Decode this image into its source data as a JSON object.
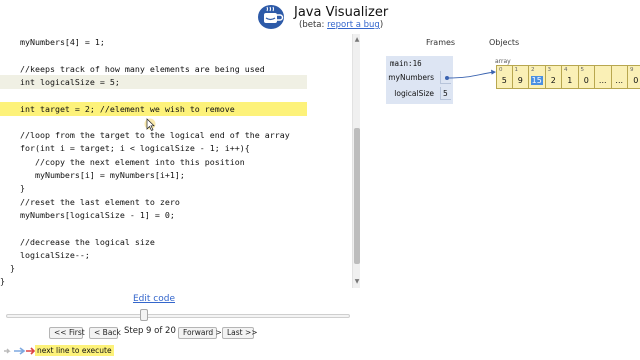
{
  "header": {
    "title": "Java Visualizer",
    "subtitle_prefix": "(beta: ",
    "report_link": "report a bug",
    "subtitle_suffix": ")",
    "logo_icon": "coffee-cup-logo"
  },
  "code": {
    "lines": [
      {
        "text": "    myNumbers[4] = 1;",
        "state": "normal"
      },
      {
        "text": "",
        "state": "normal"
      },
      {
        "text": "    //keeps track of how many elements are being used",
        "state": "normal"
      },
      {
        "text": "    int logicalSize = 5;",
        "state": "prev"
      },
      {
        "text": "",
        "state": "normal"
      },
      {
        "text": "    int target = 2; //element we wish to remove",
        "state": "cur"
      },
      {
        "text": "",
        "state": "normal"
      },
      {
        "text": "    //loop from the target to the logical end of the array",
        "state": "normal"
      },
      {
        "text": "    for(int i = target; i < logicalSize - 1; i++){",
        "state": "normal"
      },
      {
        "text": "       //copy the next element into this position",
        "state": "normal"
      },
      {
        "text": "       myNumbers[i] = myNumbers[i+1];",
        "state": "normal"
      },
      {
        "text": "    }",
        "state": "normal"
      },
      {
        "text": "    //reset the last element to zero",
        "state": "normal"
      },
      {
        "text": "    myNumbers[logicalSize - 1] = 0;",
        "state": "normal"
      },
      {
        "text": "",
        "state": "normal"
      },
      {
        "text": "    //decrease the logical size",
        "state": "normal"
      },
      {
        "text": "    logicalSize--;",
        "state": "normal"
      },
      {
        "text": "  }",
        "state": "normal"
      },
      {
        "text": "}",
        "state": "normal"
      }
    ],
    "highlight_colors": {
      "current": "#fdf27a",
      "previous": "#f0f0e4"
    }
  },
  "controls": {
    "edit_code": "Edit code",
    "first": "<< First",
    "back": "< Back",
    "step_text": "Step 9 of 20",
    "forward": "Forward >",
    "last": "Last >>",
    "slider_progress": 0.4
  },
  "legend": {
    "label": "next line to execute",
    "icon": "arrow-legend-icon"
  },
  "viz": {
    "frames_header": "Frames",
    "objects_header": "Objects",
    "frame": {
      "name": "main:16",
      "vars": [
        {
          "name": "myNumbers",
          "value": "",
          "is_pointer": true
        },
        {
          "name": "logicalSize",
          "value": "5",
          "is_pointer": false
        }
      ]
    },
    "array": {
      "label": "array",
      "cells": [
        {
          "index": "0",
          "value": "5"
        },
        {
          "index": "1",
          "value": "9"
        },
        {
          "index": "2",
          "value": "15"
        },
        {
          "index": "3",
          "value": "2"
        },
        {
          "index": "4",
          "value": "1"
        },
        {
          "index": "5",
          "value": "0"
        },
        {
          "index": "",
          "value": "..."
        },
        {
          "index": "",
          "value": "..."
        },
        {
          "index": "9",
          "value": "0"
        }
      ],
      "highlighted_index": 2
    },
    "colors": {
      "frame_bg": "#dde5f3",
      "array_bg": "#faf0b6",
      "highlight": "#4a90e2",
      "pointer": "#3a63b0"
    }
  }
}
